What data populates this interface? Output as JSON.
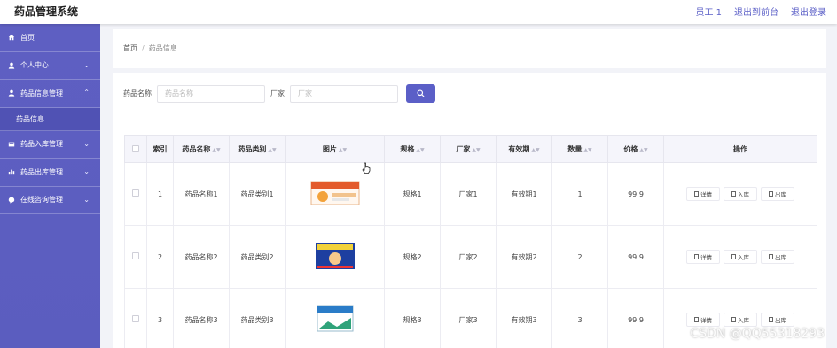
{
  "header": {
    "title": "药品管理系统",
    "links": [
      "员工 1",
      "退出到前台",
      "退出登录"
    ]
  },
  "sidebar": {
    "items": [
      {
        "label": "首页",
        "icon": "home-icon"
      },
      {
        "label": "个人中心",
        "icon": "user-icon"
      },
      {
        "label": "药品信息管理",
        "icon": "user-icon"
      },
      {
        "label": "药品信息",
        "icon": ""
      },
      {
        "label": "药品入库管理",
        "icon": "inbox-icon"
      },
      {
        "label": "药品出库管理",
        "icon": "bar-chart-icon"
      },
      {
        "label": "在线咨询管理",
        "icon": "chat-icon"
      }
    ]
  },
  "breadcrumb": {
    "home": "首页",
    "sep": "/",
    "current": "药品信息"
  },
  "search": {
    "name_label": "药品名称",
    "name_placeholder": "药品名称",
    "maker_label": "厂家",
    "maker_placeholder": "厂家"
  },
  "table": {
    "headers": [
      "索引",
      "药品名称",
      "药品类别",
      "图片",
      "规格",
      "厂家",
      "有效期",
      "数量",
      "价格",
      "操作"
    ],
    "rows": [
      {
        "index": "1",
        "name": "药品名称1",
        "category": "药品类别1",
        "spec": "规格1",
        "maker": "厂家1",
        "expiry": "有效期1",
        "qty": "1",
        "price": "99.9"
      },
      {
        "index": "2",
        "name": "药品名称2",
        "category": "药品类别2",
        "spec": "规格2",
        "maker": "厂家2",
        "expiry": "有效期2",
        "qty": "2",
        "price": "99.9"
      },
      {
        "index": "3",
        "name": "药品名称3",
        "category": "药品类别3",
        "spec": "规格3",
        "maker": "厂家3",
        "expiry": "有效期3",
        "qty": "3",
        "price": "99.9"
      }
    ],
    "actions": [
      "详情",
      "入库",
      "出库"
    ]
  },
  "watermark": "CSDN @QQ55318293",
  "colors": {
    "accent": "#5b5fc7",
    "sidebar": "#5e5fc2"
  }
}
